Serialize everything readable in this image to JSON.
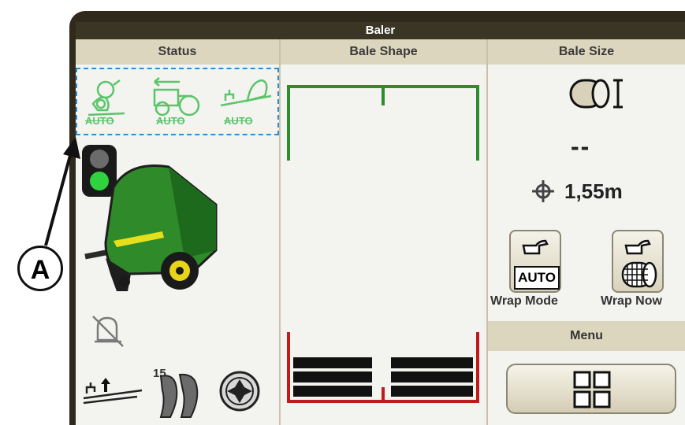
{
  "title": "Baler",
  "columns": {
    "status": "Status",
    "bale_shape": "Bale Shape",
    "bale_size": "Bale Size"
  },
  "status_icons": [
    {
      "name": "knife-auto-icon",
      "label": "AUTO"
    },
    {
      "name": "tractor-auto-icon",
      "label": "AUTO"
    },
    {
      "name": "pickup-auto-icon",
      "label": "AUTO"
    }
  ],
  "bale_size": {
    "size_value": "--",
    "diameter_value": "1,55m"
  },
  "wrap_mode": {
    "button_text": "AUTO",
    "label": "Wrap Mode"
  },
  "wrap_now": {
    "label": "Wrap Now"
  },
  "menu": {
    "label": "Menu"
  },
  "pickup_count": "15",
  "callout": "A",
  "colors": {
    "accent_green": "#2e8b2e",
    "status_green": "#5cc46a",
    "shape_red": "#c01b1b",
    "frame": "#3a3524"
  }
}
